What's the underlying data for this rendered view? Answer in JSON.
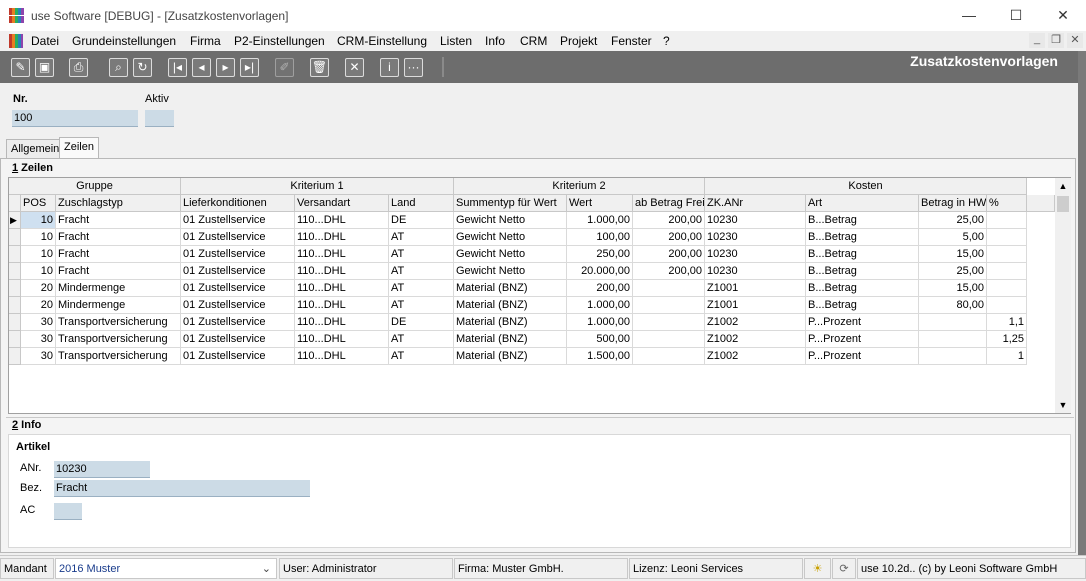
{
  "window": {
    "title": "use Software [DEBUG] - [Zusatzkostenvorlagen]",
    "minimize": "—",
    "maximize": "☐",
    "close": "✕"
  },
  "menu": [
    "Datei",
    "Grundeinstellungen",
    "Firma",
    "P2-Einstellungen",
    "CRM-Einstellung",
    "Listen",
    "Info",
    "CRM",
    "Projekt",
    "Fenster",
    "?"
  ],
  "toolbar": {
    "title": "Zusatzkostenvorlagen"
  },
  "header": {
    "nr_label": "Nr.",
    "nr_value": "100",
    "aktiv_label": "Aktiv",
    "aktiv_value": ""
  },
  "tabs": [
    "Allgemein",
    "Zeilen"
  ],
  "zeilen": {
    "section_number": "1",
    "section_title": " Zeilen",
    "groups": [
      "Gruppe",
      "Kriterium 1",
      "Kriterium 2",
      "Kosten"
    ],
    "columns": [
      "POS",
      "Zuschlagstyp",
      "Lieferkonditionen",
      "Versandart",
      "Land",
      "Summentyp für Wert",
      "Wert",
      "ab Betrag Frei",
      "ZK.ANr",
      "Art",
      "Betrag in HW",
      "%"
    ],
    "rows": [
      [
        "10",
        "Fracht",
        "01 Zustellservice",
        "110...DHL",
        "DE",
        "Gewicht Netto",
        "1.000,00",
        "200,00",
        "10230",
        "B...Betrag",
        "25,00",
        ""
      ],
      [
        "10",
        "Fracht",
        "01 Zustellservice",
        "110...DHL",
        "AT",
        "Gewicht Netto",
        "100,00",
        "200,00",
        "10230",
        "B...Betrag",
        "5,00",
        ""
      ],
      [
        "10",
        "Fracht",
        "01 Zustellservice",
        "110...DHL",
        "AT",
        "Gewicht Netto",
        "250,00",
        "200,00",
        "10230",
        "B...Betrag",
        "15,00",
        ""
      ],
      [
        "10",
        "Fracht",
        "01 Zustellservice",
        "110...DHL",
        "AT",
        "Gewicht Netto",
        "20.000,00",
        "200,00",
        "10230",
        "B...Betrag",
        "25,00",
        ""
      ],
      [
        "20",
        "Mindermenge",
        "01 Zustellservice",
        "110...DHL",
        "AT",
        "Material (BNZ)",
        "200,00",
        "",
        "Z1001",
        "B...Betrag",
        "15,00",
        ""
      ],
      [
        "20",
        "Mindermenge",
        "01 Zustellservice",
        "110...DHL",
        "AT",
        "Material (BNZ)",
        "1.000,00",
        "",
        "Z1001",
        "B...Betrag",
        "80,00",
        ""
      ],
      [
        "30",
        "Transportversicherung",
        "01 Zustellservice",
        "110...DHL",
        "DE",
        "Material (BNZ)",
        "1.000,00",
        "",
        "Z1002",
        "P...Prozent",
        "",
        "1,1"
      ],
      [
        "30",
        "Transportversicherung",
        "01 Zustellservice",
        "110...DHL",
        "AT",
        "Material (BNZ)",
        "500,00",
        "",
        "Z1002",
        "P...Prozent",
        "",
        "1,25"
      ],
      [
        "30",
        "Transportversicherung",
        "01 Zustellservice",
        "110...DHL",
        "AT",
        "Material (BNZ)",
        "1.500,00",
        "",
        "Z1002",
        "P...Prozent",
        "",
        "1"
      ]
    ]
  },
  "info": {
    "section_number": "2",
    "section_title": " Info",
    "group": "Artikel",
    "anr_label": "ANr.",
    "anr_value": "10230",
    "bez_label": "Bez.",
    "bez_value": "Fracht",
    "ac_label": "AC",
    "ac_value": ""
  },
  "status": {
    "mandant_label": "Mandant",
    "mandant_value": "2016 Muster",
    "user": "User: Administrator",
    "firma": "Firma: Muster GmbH.",
    "lizenz": "Lizenz: Leoni Services",
    "version": "use 10.2d.. (c) by Leoni Software GmbH"
  }
}
